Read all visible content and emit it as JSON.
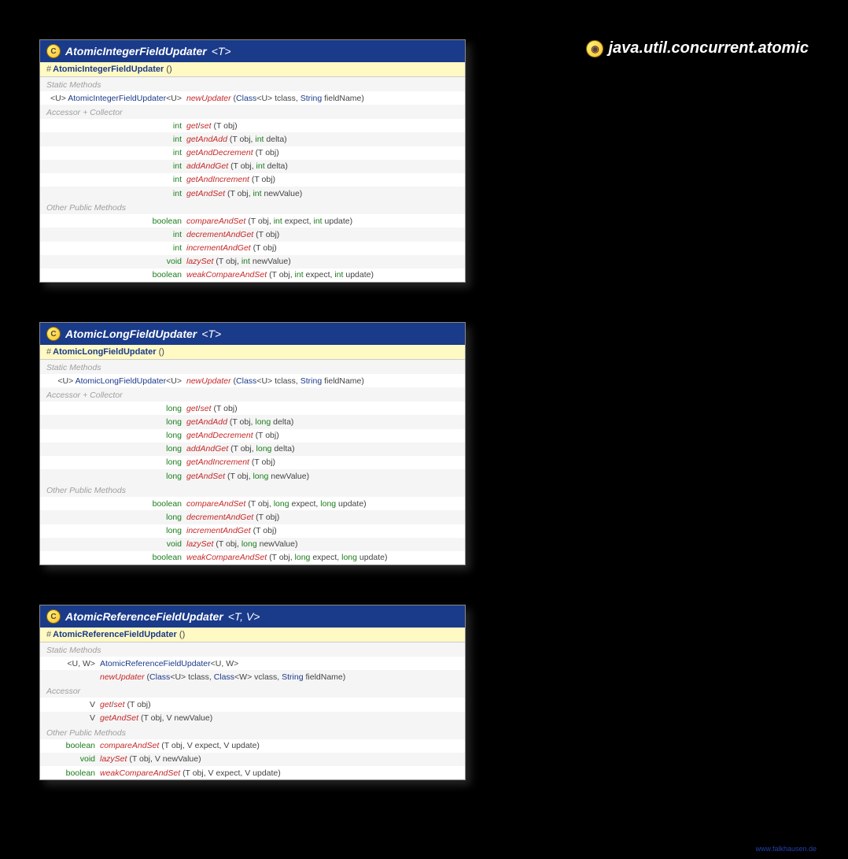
{
  "package": "java.util.concurrent.atomic",
  "watermark": "www.falkhausen.de",
  "classes": [
    {
      "name": "AtomicIntegerFieldUpdater",
      "typeParams": "<T>",
      "constructor": "AtomicIntegerFieldUpdater",
      "constructorArgs": "()",
      "narrow": false,
      "sections": [
        {
          "label": "Static Methods",
          "rows": [
            {
              "ret": [
                {
                  "t": "p",
                  "v": "<U> "
                },
                {
                  "t": "link",
                  "v": "AtomicIntegerFieldUpdater"
                },
                {
                  "t": "p",
                  "v": "<U>"
                }
              ],
              "name": "newUpdater",
              "abs": false,
              "params": [
                {
                  "t": "p",
                  "v": "("
                },
                {
                  "t": "link",
                  "v": "Class"
                },
                {
                  "t": "p",
                  "v": "<U> tclass, "
                },
                {
                  "t": "link",
                  "v": "String"
                },
                {
                  "t": "p",
                  "v": " fieldName)"
                }
              ]
            }
          ]
        },
        {
          "label": "Accessor + Collector",
          "rows": [
            {
              "ret": [
                {
                  "t": "kw",
                  "v": "int"
                }
              ],
              "name": "get",
              "slash": "set",
              "abs": true,
              "params": [
                {
                  "t": "p",
                  "v": "(T obj)"
                }
              ]
            },
            {
              "ret": [
                {
                  "t": "kw",
                  "v": "int"
                }
              ],
              "name": "getAndAdd",
              "abs": false,
              "params": [
                {
                  "t": "p",
                  "v": "(T obj, "
                },
                {
                  "t": "kw",
                  "v": "int"
                },
                {
                  "t": "p",
                  "v": " delta)"
                }
              ]
            },
            {
              "ret": [
                {
                  "t": "kw",
                  "v": "int"
                }
              ],
              "name": "getAndDecrement",
              "abs": false,
              "params": [
                {
                  "t": "p",
                  "v": "(T obj)"
                }
              ]
            },
            {
              "ret": [
                {
                  "t": "kw",
                  "v": "int"
                }
              ],
              "name": "addAndGet",
              "abs": false,
              "params": [
                {
                  "t": "p",
                  "v": "(T obj, "
                },
                {
                  "t": "kw",
                  "v": "int"
                },
                {
                  "t": "p",
                  "v": " delta)"
                }
              ]
            },
            {
              "ret": [
                {
                  "t": "kw",
                  "v": "int"
                }
              ],
              "name": "getAndIncrement",
              "abs": false,
              "params": [
                {
                  "t": "p",
                  "v": "(T obj)"
                }
              ]
            },
            {
              "ret": [
                {
                  "t": "kw",
                  "v": "int"
                }
              ],
              "name": "getAndSet",
              "abs": false,
              "params": [
                {
                  "t": "p",
                  "v": "(T obj, "
                },
                {
                  "t": "kw",
                  "v": "int"
                },
                {
                  "t": "p",
                  "v": " newValue)"
                }
              ]
            }
          ]
        },
        {
          "label": "Other Public Methods",
          "rows": [
            {
              "ret": [
                {
                  "t": "kw",
                  "v": "boolean"
                }
              ],
              "name": "compareAndSet",
              "abs": true,
              "params": [
                {
                  "t": "p",
                  "v": "(T obj, "
                },
                {
                  "t": "kw",
                  "v": "int"
                },
                {
                  "t": "p",
                  "v": " expect, "
                },
                {
                  "t": "kw",
                  "v": "int"
                },
                {
                  "t": "p",
                  "v": " update)"
                }
              ]
            },
            {
              "ret": [
                {
                  "t": "kw",
                  "v": "int"
                }
              ],
              "name": "decrementAndGet",
              "abs": false,
              "params": [
                {
                  "t": "p",
                  "v": "(T obj)"
                }
              ]
            },
            {
              "ret": [
                {
                  "t": "kw",
                  "v": "int"
                }
              ],
              "name": "incrementAndGet",
              "abs": false,
              "params": [
                {
                  "t": "p",
                  "v": "(T obj)"
                }
              ]
            },
            {
              "ret": [
                {
                  "t": "kw",
                  "v": "void"
                }
              ],
              "name": "lazySet",
              "abs": true,
              "params": [
                {
                  "t": "p",
                  "v": "(T obj, "
                },
                {
                  "t": "kw",
                  "v": "int"
                },
                {
                  "t": "p",
                  "v": " newValue)"
                }
              ]
            },
            {
              "ret": [
                {
                  "t": "kw",
                  "v": "boolean"
                }
              ],
              "name": "weakCompareAndSet",
              "abs": true,
              "params": [
                {
                  "t": "p",
                  "v": "(T obj, "
                },
                {
                  "t": "kw",
                  "v": "int"
                },
                {
                  "t": "p",
                  "v": " expect, "
                },
                {
                  "t": "kw",
                  "v": "int"
                },
                {
                  "t": "p",
                  "v": " update)"
                }
              ]
            }
          ]
        }
      ]
    },
    {
      "name": "AtomicLongFieldUpdater",
      "typeParams": "<T>",
      "constructor": "AtomicLongFieldUpdater",
      "constructorArgs": "()",
      "narrow": false,
      "sections": [
        {
          "label": "Static Methods",
          "rows": [
            {
              "ret": [
                {
                  "t": "p",
                  "v": "<U> "
                },
                {
                  "t": "link",
                  "v": "AtomicLongFieldUpdater"
                },
                {
                  "t": "p",
                  "v": "<U>"
                }
              ],
              "name": "newUpdater",
              "abs": false,
              "params": [
                {
                  "t": "p",
                  "v": "("
                },
                {
                  "t": "link",
                  "v": "Class"
                },
                {
                  "t": "p",
                  "v": "<U> tclass, "
                },
                {
                  "t": "link",
                  "v": "String"
                },
                {
                  "t": "p",
                  "v": " fieldName)"
                }
              ]
            }
          ]
        },
        {
          "label": "Accessor + Collector",
          "rows": [
            {
              "ret": [
                {
                  "t": "kw",
                  "v": "long"
                }
              ],
              "name": "get",
              "slash": "set",
              "abs": true,
              "params": [
                {
                  "t": "p",
                  "v": "(T obj)"
                }
              ]
            },
            {
              "ret": [
                {
                  "t": "kw",
                  "v": "long"
                }
              ],
              "name": "getAndAdd",
              "abs": false,
              "params": [
                {
                  "t": "p",
                  "v": "(T obj, "
                },
                {
                  "t": "kw",
                  "v": "long"
                },
                {
                  "t": "p",
                  "v": " delta)"
                }
              ]
            },
            {
              "ret": [
                {
                  "t": "kw",
                  "v": "long"
                }
              ],
              "name": "getAndDecrement",
              "abs": false,
              "params": [
                {
                  "t": "p",
                  "v": "(T obj)"
                }
              ]
            },
            {
              "ret": [
                {
                  "t": "kw",
                  "v": "long"
                }
              ],
              "name": "addAndGet",
              "abs": false,
              "params": [
                {
                  "t": "p",
                  "v": "(T obj, "
                },
                {
                  "t": "kw",
                  "v": "long"
                },
                {
                  "t": "p",
                  "v": " delta)"
                }
              ]
            },
            {
              "ret": [
                {
                  "t": "kw",
                  "v": "long"
                }
              ],
              "name": "getAndIncrement",
              "abs": false,
              "params": [
                {
                  "t": "p",
                  "v": "(T obj)"
                }
              ]
            },
            {
              "ret": [
                {
                  "t": "kw",
                  "v": "long"
                }
              ],
              "name": "getAndSet",
              "abs": false,
              "params": [
                {
                  "t": "p",
                  "v": "(T obj, "
                },
                {
                  "t": "kw",
                  "v": "long"
                },
                {
                  "t": "p",
                  "v": " newValue)"
                }
              ]
            }
          ]
        },
        {
          "label": "Other Public Methods",
          "rows": [
            {
              "ret": [
                {
                  "t": "kw",
                  "v": "boolean"
                }
              ],
              "name": "compareAndSet",
              "abs": true,
              "params": [
                {
                  "t": "p",
                  "v": "(T obj, "
                },
                {
                  "t": "kw",
                  "v": "long"
                },
                {
                  "t": "p",
                  "v": " expect, "
                },
                {
                  "t": "kw",
                  "v": "long"
                },
                {
                  "t": "p",
                  "v": " update)"
                }
              ]
            },
            {
              "ret": [
                {
                  "t": "kw",
                  "v": "long"
                }
              ],
              "name": "decrementAndGet",
              "abs": false,
              "params": [
                {
                  "t": "p",
                  "v": "(T obj)"
                }
              ]
            },
            {
              "ret": [
                {
                  "t": "kw",
                  "v": "long"
                }
              ],
              "name": "incrementAndGet",
              "abs": false,
              "params": [
                {
                  "t": "p",
                  "v": "(T obj)"
                }
              ]
            },
            {
              "ret": [
                {
                  "t": "kw",
                  "v": "void"
                }
              ],
              "name": "lazySet",
              "abs": true,
              "params": [
                {
                  "t": "p",
                  "v": "(T obj, "
                },
                {
                  "t": "kw",
                  "v": "long"
                },
                {
                  "t": "p",
                  "v": " newValue)"
                }
              ]
            },
            {
              "ret": [
                {
                  "t": "kw",
                  "v": "boolean"
                }
              ],
              "name": "weakCompareAndSet",
              "abs": true,
              "params": [
                {
                  "t": "p",
                  "v": "(T obj, "
                },
                {
                  "t": "kw",
                  "v": "long"
                },
                {
                  "t": "p",
                  "v": " expect, "
                },
                {
                  "t": "kw",
                  "v": "long"
                },
                {
                  "t": "p",
                  "v": " update)"
                }
              ]
            }
          ]
        }
      ]
    },
    {
      "name": "AtomicReferenceFieldUpdater",
      "typeParams": "<T, V>",
      "constructor": "AtomicReferenceFieldUpdater",
      "constructorArgs": "()",
      "narrow": true,
      "sections": [
        {
          "label": "Static Methods",
          "rows": [
            {
              "ret": [
                {
                  "t": "p",
                  "v": "<U, W>"
                }
              ],
              "retOnly": true,
              "name": "",
              "abs": false,
              "params": [
                {
                  "t": "link",
                  "v": "AtomicReferenceFieldUpdater"
                },
                {
                  "t": "p",
                  "v": "<U, W>"
                }
              ]
            },
            {
              "ret": [],
              "name": "newUpdater",
              "abs": false,
              "params": [
                {
                  "t": "p",
                  "v": "("
                },
                {
                  "t": "link",
                  "v": "Class"
                },
                {
                  "t": "p",
                  "v": "<U> tclass, "
                },
                {
                  "t": "link",
                  "v": "Class"
                },
                {
                  "t": "p",
                  "v": "<W> vclass, "
                },
                {
                  "t": "link",
                  "v": "String"
                },
                {
                  "t": "p",
                  "v": " fieldName)"
                }
              ]
            }
          ]
        },
        {
          "label": "Accessor",
          "rows": [
            {
              "ret": [
                {
                  "t": "p",
                  "v": "V"
                }
              ],
              "name": "get",
              "slash": "set",
              "abs": true,
              "params": [
                {
                  "t": "p",
                  "v": "(T obj)"
                }
              ]
            },
            {
              "ret": [
                {
                  "t": "p",
                  "v": "V"
                }
              ],
              "name": "getAndSet",
              "abs": false,
              "params": [
                {
                  "t": "p",
                  "v": "(T obj, V newValue)"
                }
              ]
            }
          ]
        },
        {
          "label": "Other Public Methods",
          "rows": [
            {
              "ret": [
                {
                  "t": "kw",
                  "v": "boolean"
                }
              ],
              "name": "compareAndSet",
              "abs": true,
              "params": [
                {
                  "t": "p",
                  "v": "(T obj, V expect, V update)"
                }
              ]
            },
            {
              "ret": [
                {
                  "t": "kw",
                  "v": "void"
                }
              ],
              "name": "lazySet",
              "abs": true,
              "params": [
                {
                  "t": "p",
                  "v": "(T obj, V newValue)"
                }
              ]
            },
            {
              "ret": [
                {
                  "t": "kw",
                  "v": "boolean"
                }
              ],
              "name": "weakCompareAndSet",
              "abs": true,
              "params": [
                {
                  "t": "p",
                  "v": "(T obj, V expect, V update)"
                }
              ]
            }
          ]
        }
      ]
    }
  ]
}
